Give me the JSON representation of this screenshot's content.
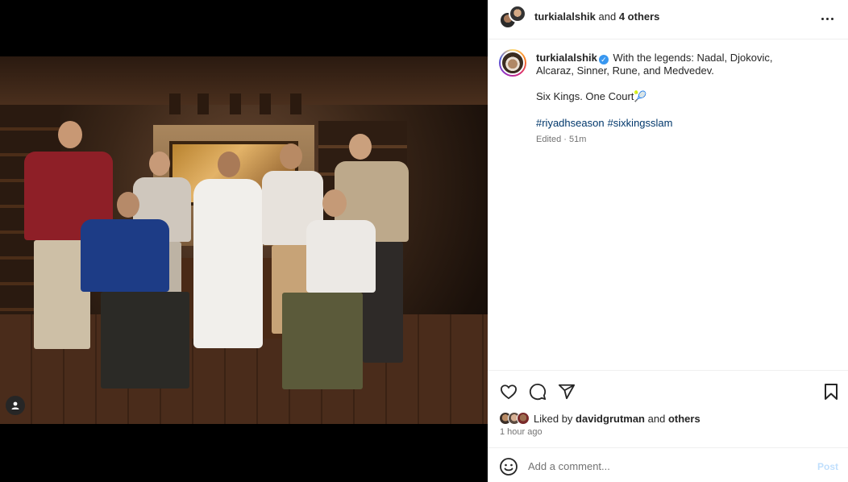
{
  "header": {
    "username": "turkialalshik",
    "and_text": "and",
    "others": "4 others",
    "more_icon": "more-horizontal-icon"
  },
  "caption": {
    "username": "turkialalshik",
    "verified_icon": "verified-badge-icon",
    "verified_glyph": "✓",
    "text": "With the legends: Nadal, Djokovic, Alcaraz, Sinner, Rune, and Medvedev.",
    "line2": "Six Kings. One Court🎾",
    "hashtags": [
      "#riyadhseason",
      "#sixkingsslam"
    ],
    "meta": "Edited · 51m"
  },
  "actions": {
    "like_icon": "heart-icon",
    "comment_icon": "comment-icon",
    "share_icon": "share-icon",
    "save_icon": "bookmark-icon"
  },
  "likes": {
    "prefix": "Liked by",
    "user": "davidgrutman",
    "conjunction": "and",
    "others": "others"
  },
  "time": "1 hour ago",
  "comment": {
    "placeholder": "Add a comment...",
    "post_label": "Post",
    "emoji_icon": "emoji-icon"
  },
  "media": {
    "tag_icon": "user-tag-icon"
  },
  "colors": {
    "link": "#00376b",
    "verified": "#3897f0",
    "post_disabled": "#c0dffd",
    "muted": "#737373"
  }
}
